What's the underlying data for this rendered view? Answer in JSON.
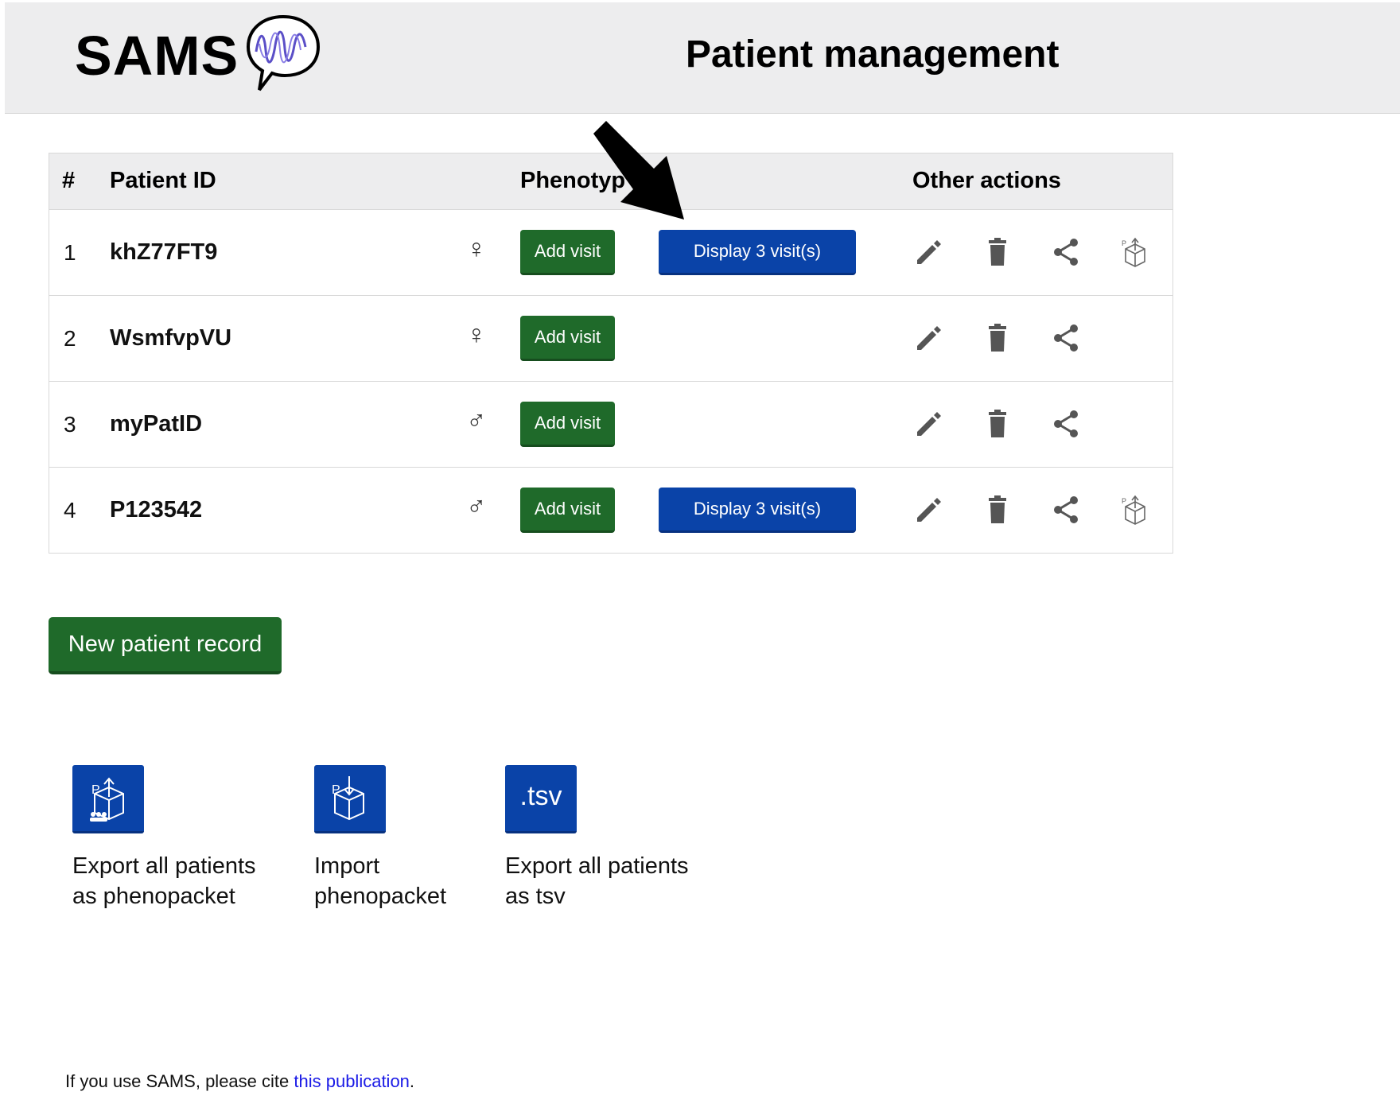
{
  "header": {
    "logo_text": "SAMS",
    "title": "Patient management"
  },
  "table": {
    "columns": {
      "num": "#",
      "patient_id": "Patient ID",
      "phenotype": "Phenotyp",
      "other_actions": "Other actions"
    },
    "rows": [
      {
        "num": "1",
        "id": "khZ77FT9",
        "sex": "♀",
        "add_label": "Add visit",
        "display_label": "Display 3 visit(s)"
      },
      {
        "num": "2",
        "id": "WsmfvpVU",
        "sex": "♀",
        "add_label": "Add visit"
      },
      {
        "num": "3",
        "id": "myPatID",
        "sex": "♂",
        "add_label": "Add visit"
      },
      {
        "num": "4",
        "id": "P123542",
        "sex": "♂",
        "add_label": "Add visit",
        "display_label": "Display 3 visit(s)"
      }
    ]
  },
  "new_patient_label": "New patient record",
  "tools": [
    {
      "icon": "export-phenopacket-icon",
      "line1": "Export all patients",
      "line2": "as phenopacket"
    },
    {
      "icon": "import-phenopacket-icon",
      "line1": "Import",
      "line2": "phenopacket"
    },
    {
      "icon": "tsv-icon",
      "text": ".tsv",
      "line1": "Export all patients",
      "line2": "as tsv"
    }
  ],
  "footer": {
    "text_before": "If you use SAMS, please cite ",
    "link_text": "this publication",
    "text_after": "."
  },
  "colors": {
    "green": "#1f6a2a",
    "blue": "#0a43a8",
    "header_bg": "#ededee",
    "link": "#1a1ae6"
  }
}
